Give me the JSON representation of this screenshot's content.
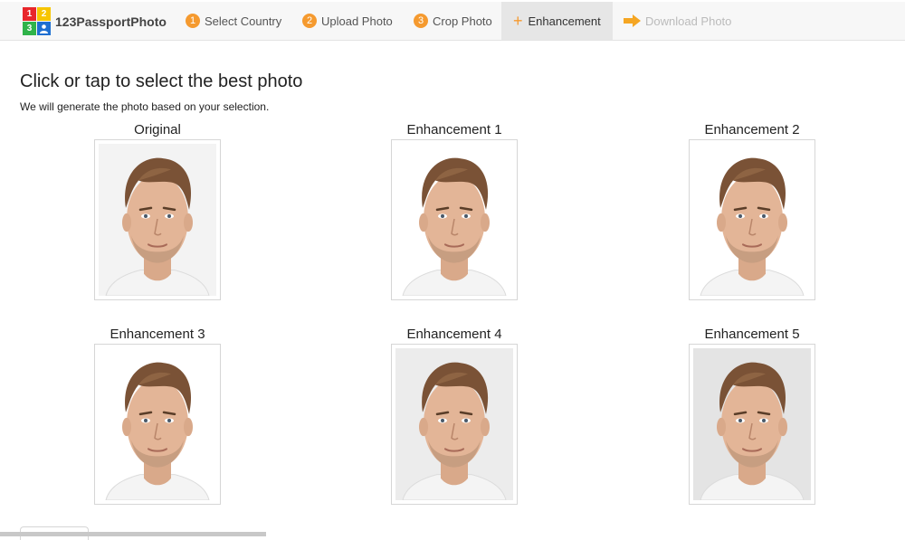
{
  "brand": {
    "logo_digits": [
      "1",
      "2",
      "3"
    ],
    "name": "123PassportPhoto",
    "colors": {
      "red": "#e8262b",
      "yellow": "#f7c500",
      "green": "#2fb34a",
      "blue": "#1f6fd1"
    }
  },
  "steps": [
    {
      "num": "1",
      "label": "Select Country",
      "state": "done"
    },
    {
      "num": "2",
      "label": "Upload Photo",
      "state": "done"
    },
    {
      "num": "3",
      "label": "Crop Photo",
      "state": "done"
    },
    {
      "label": "Enhancement",
      "state": "active",
      "icon": "plus-icon"
    },
    {
      "label": "Download Photo",
      "state": "disabled",
      "icon": "arrow-right-icon"
    }
  ],
  "accent_color": "#f59a2f",
  "main": {
    "title": "Click or tap to select the best photo",
    "subtitle": "We will generate the photo based on your selection."
  },
  "photos": [
    {
      "label": "Original",
      "background": "#f3f3f3"
    },
    {
      "label": "Enhancement 1",
      "background": "#ffffff"
    },
    {
      "label": "Enhancement 2",
      "background": "#ffffff"
    },
    {
      "label": "Enhancement 3",
      "background": "#ffffff"
    },
    {
      "label": "Enhancement 4",
      "background": "#ececec"
    },
    {
      "label": "Enhancement 5",
      "background": "#e4e4e4"
    }
  ]
}
